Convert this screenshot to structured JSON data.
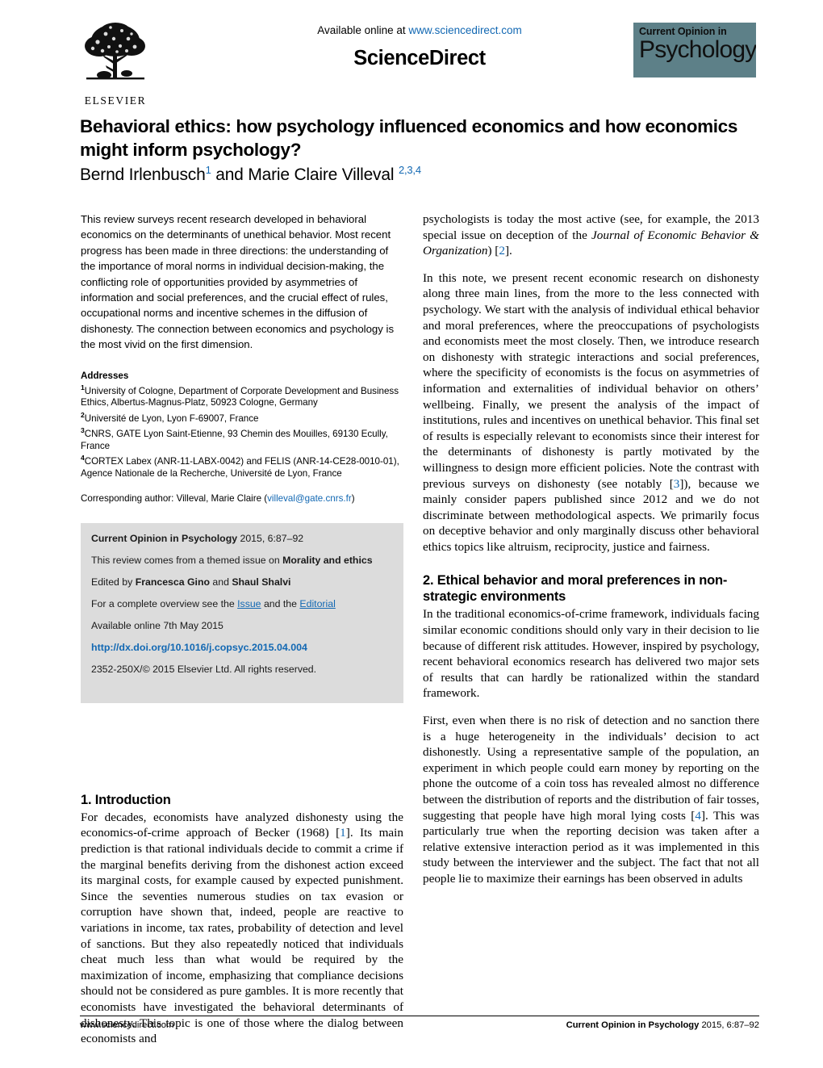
{
  "header": {
    "publisher_name": "ELSEVIER",
    "publisher_logo_icon": "elsevier-tree-logo",
    "available_online_prefix": "Available online at",
    "sciencedirect_url": "www.sciencedirect.com",
    "sciencedirect_wordmark": "ScienceDirect",
    "journal_logo_top": "Current Opinion in",
    "journal_logo_main": "Psychology",
    "journal_logo_color": "#5d8088",
    "link_color": "#1268b3"
  },
  "article": {
    "title": "Behavioral ethics: how psychology influenced economics and how economics might inform psychology?",
    "authors_part1": "Bernd Irlenbusch",
    "authors_sup1": "1",
    "authors_conj": " and ",
    "authors_part2": "Marie Claire Villeval ",
    "authors_sup2": "2,3,4"
  },
  "abstract": {
    "text": "This review surveys recent research developed in behavioral economics on the determinants of unethical behavior. Most recent progress has been made in three directions: the understanding of the importance of moral norms in individual decision-making, the conflicting role of opportunities provided by asymmetries of information and social preferences, and the crucial effect of rules, occupational norms and incentive schemes in the diffusion of dishonesty. The connection between economics and psychology is the most vivid on the first dimension."
  },
  "addresses": {
    "heading": "Addresses",
    "items": [
      {
        "sup": "1",
        "text": "University of Cologne, Department of Corporate Development and Business Ethics, Albertus-Magnus-Platz, 50923 Cologne, Germany"
      },
      {
        "sup": "2",
        "text": "Université de Lyon, Lyon F-69007, France"
      },
      {
        "sup": "3",
        "text": "CNRS, GATE Lyon Saint-Etienne, 93 Chemin des Mouilles, 69130 Ecully, France"
      },
      {
        "sup": "4",
        "text": "CORTEX Labex (ANR-11-LABX-0042) and FELIS (ANR-14-CE28-0010-01), Agence Nationale de la Recherche, Université de Lyon, France"
      }
    ],
    "corresponding_prefix": "Corresponding author: Villeval, Marie Claire (",
    "corresponding_email": "villeval@gate.cnrs.fr",
    "corresponding_suffix": ")"
  },
  "infobox": {
    "citation_journal": "Current Opinion in Psychology",
    "citation_rest": " 2015, 6:87–92",
    "themed_prefix": "This review comes from a themed issue on ",
    "themed_topic": "Morality and ethics",
    "edited_prefix": "Edited by ",
    "editor1": "Francesca Gino",
    "edited_conj": " and ",
    "editor2": "Shaul Shalvi",
    "overview_prefix": "For a complete overview see the ",
    "overview_link1": "Issue",
    "overview_mid": " and the ",
    "overview_link2": "Editorial",
    "available_online": "Available online 7th May 2015",
    "doi": "http://dx.doi.org/10.1016/j.copsyc.2015.04.004",
    "issn_copyright": "2352-250X/© 2015 Elsevier Ltd. All rights reserved."
  },
  "sections": {
    "intro": {
      "heading": "1. Introduction",
      "para1_a": "For decades, economists have analyzed dishonesty using the economics-of-crime approach of Becker (1968) [",
      "para1_ref": "1",
      "para1_b": "]. Its main prediction is that rational individuals decide to commit a crime if the marginal benefits deriving from the dishonest action exceed its marginal costs, for example caused by expected punishment. Since the seventies numerous studies on tax evasion or corruption have shown that, indeed, people are reactive to variations in income, tax rates, probability of detection and level of sanctions. But they also repeatedly noticed that individuals cheat much less than what would be required by the maximization of income, emphasizing that compliance decisions should not be considered as pure gambles. It is more recently that economists have investigated the behavioral determinants of dishonesty. This topic is one of those where the dialog between economists and"
    },
    "right_top": {
      "para_a": "psychologists is today the most active (see, for example, the 2013 special issue on deception of the ",
      "para_italic": "Journal of Economic Behavior & Organization",
      "para_b": ") [",
      "para_ref": "2",
      "para_c": "]."
    },
    "note": {
      "para_a": "In this note, we present recent economic research on dishonesty along three main lines, from the more to the less connected with psychology. We start with the analysis of individual ethical behavior and moral preferences, where the preoccupations of psychologists and economists meet the most closely. Then, we introduce research on dishonesty with strategic interactions and social preferences, where the specificity of economists is the focus on asymmetries of information and externalities of individual behavior on others’ wellbeing. Finally, we present the analysis of the impact of institutions, rules and incentives on unethical behavior. This final set of results is especially relevant to economists since their interest for the determinants of dishonesty is partly motivated by the willingness to design more efficient policies. Note the contrast with previous surveys on dishonesty (see notably [",
      "para_ref": "3",
      "para_b": "]), because we mainly consider papers published since 2012 and we do not discriminate between methodological aspects. We primarily focus on deceptive behavior and only marginally discuss other behavioral ethics topics like altruism, reciprocity, justice and fairness."
    },
    "ethical": {
      "heading": "2. Ethical behavior and moral preferences in non-strategic environments",
      "para1": "In the traditional economics-of-crime framework, individuals facing similar economic conditions should only vary in their decision to lie because of different risk attitudes. However, inspired by psychology, recent behavioral economics research has delivered two major sets of results that can hardly be rationalized within the standard framework.",
      "para2_a": "First, even when there is no risk of detection and no sanction there is a huge heterogeneity in the individuals’ decision to act dishonestly. Using a representative sample of the population, an experiment in which people could earn money by reporting on the phone the outcome of a coin toss has revealed almost no difference between the distribution of reports and the distribution of fair tosses, suggesting that people have high moral lying costs [",
      "para2_ref": "4",
      "para2_b": "]. This was particularly true when the reporting decision was taken after a relative extensive interaction period as it was implemented in this study between the interviewer and the subject. The fact that not all people lie to maximize their earnings has been observed in adults"
    }
  },
  "footer": {
    "left": "www.sciencedirect.com",
    "right_journal": "Current Opinion in Psychology",
    "right_rest": " 2015, 6:87–92"
  }
}
